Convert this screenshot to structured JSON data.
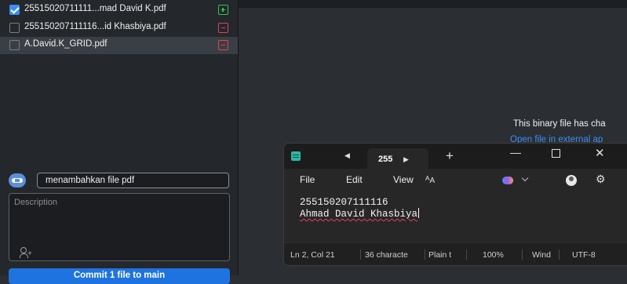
{
  "sidebar": {
    "files": [
      {
        "name": "25515020711111...mad David K.pdf",
        "checked": true,
        "status": "added"
      },
      {
        "name": "255150207111116...id Khasbiya.pdf",
        "checked": false,
        "status": "removed"
      },
      {
        "name": "A.David.K_GRID.pdf",
        "checked": false,
        "status": "removed"
      }
    ],
    "commit_summary": "menambahkan file pdf",
    "description_placeholder": "Description",
    "commit_button": "Commit 1 file to main"
  },
  "diff": {
    "binary_message": "This binary file has cha",
    "open_external": "Open file in external ap"
  },
  "notepad": {
    "tab_label": "255",
    "menu": {
      "file": "File",
      "edit": "Edit",
      "view": "View"
    },
    "lines": [
      "255150207111116",
      "Ahmad David Khasbiya"
    ],
    "status": {
      "position": "Ln 2, Col 21",
      "characters": "36 characte",
      "format": "Plain t",
      "zoom": "100%",
      "line_ending": "Wind",
      "encoding": "UTF-8"
    },
    "icons": {
      "app": "notepad-icon",
      "prev": "tab-prev-icon",
      "next": "tab-next-icon",
      "new_tab": "plus-icon",
      "text_format": "text-format-icon",
      "copilot": "copilot-icon",
      "profile": "profile-icon",
      "settings": "gear-icon"
    }
  },
  "colors": {
    "accent": "#1f73e0",
    "added": "#31c34e",
    "removed": "#e1444f"
  }
}
